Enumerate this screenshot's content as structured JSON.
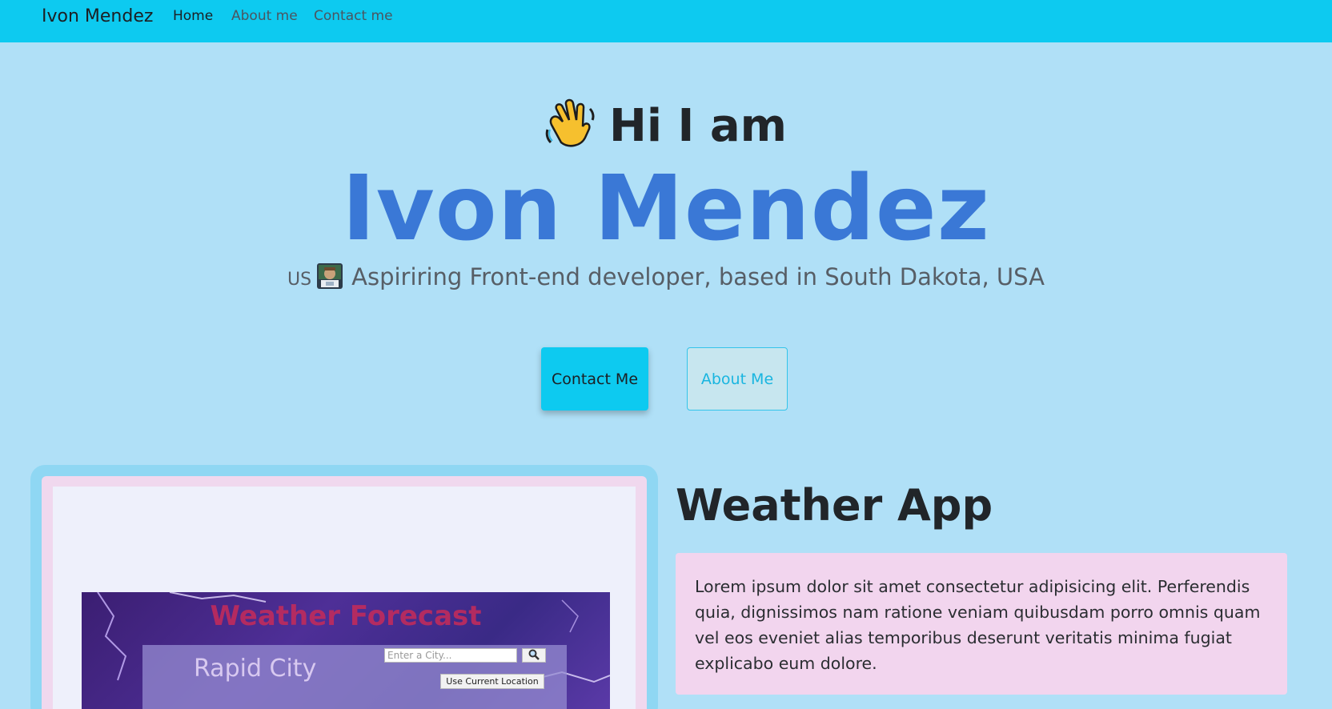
{
  "navbar": {
    "brand": "Ivon Mendez",
    "links": [
      "Home",
      "About me",
      "Contact me"
    ]
  },
  "hero": {
    "greeting": "Hi I am",
    "name": "Ivon Mendez",
    "flag": "US",
    "tagline": "Aspiriring Front-end developer, based in South Dakota, USA",
    "contact_button": "Contact Me",
    "about_button": "About Me"
  },
  "project": {
    "title": "Weather App",
    "description": "Lorem ipsum dolor sit amet consectetur adipisicing elit. Perferendis quia, dignissimos nam ratione veniam quibusdam porro omnis quam vel eos eveniet alias temporibus deserunt veritatis minima fugiat explicabo eum dolore.",
    "screenshot": {
      "heading": "Weather Forecast",
      "city": "Rapid City",
      "input_placeholder": "Enter a City...",
      "search_icon": "magnifier-icon",
      "location_button": "Use Current Location"
    }
  },
  "colors": {
    "navbar": "#0dcaf0",
    "background": "#b0e0f7",
    "name_accent": "#3a78d6",
    "description_bg": "#f2d5ee"
  },
  "icons": {
    "greeting": "waving-hand-icon",
    "tagline": "technologist-icon"
  }
}
